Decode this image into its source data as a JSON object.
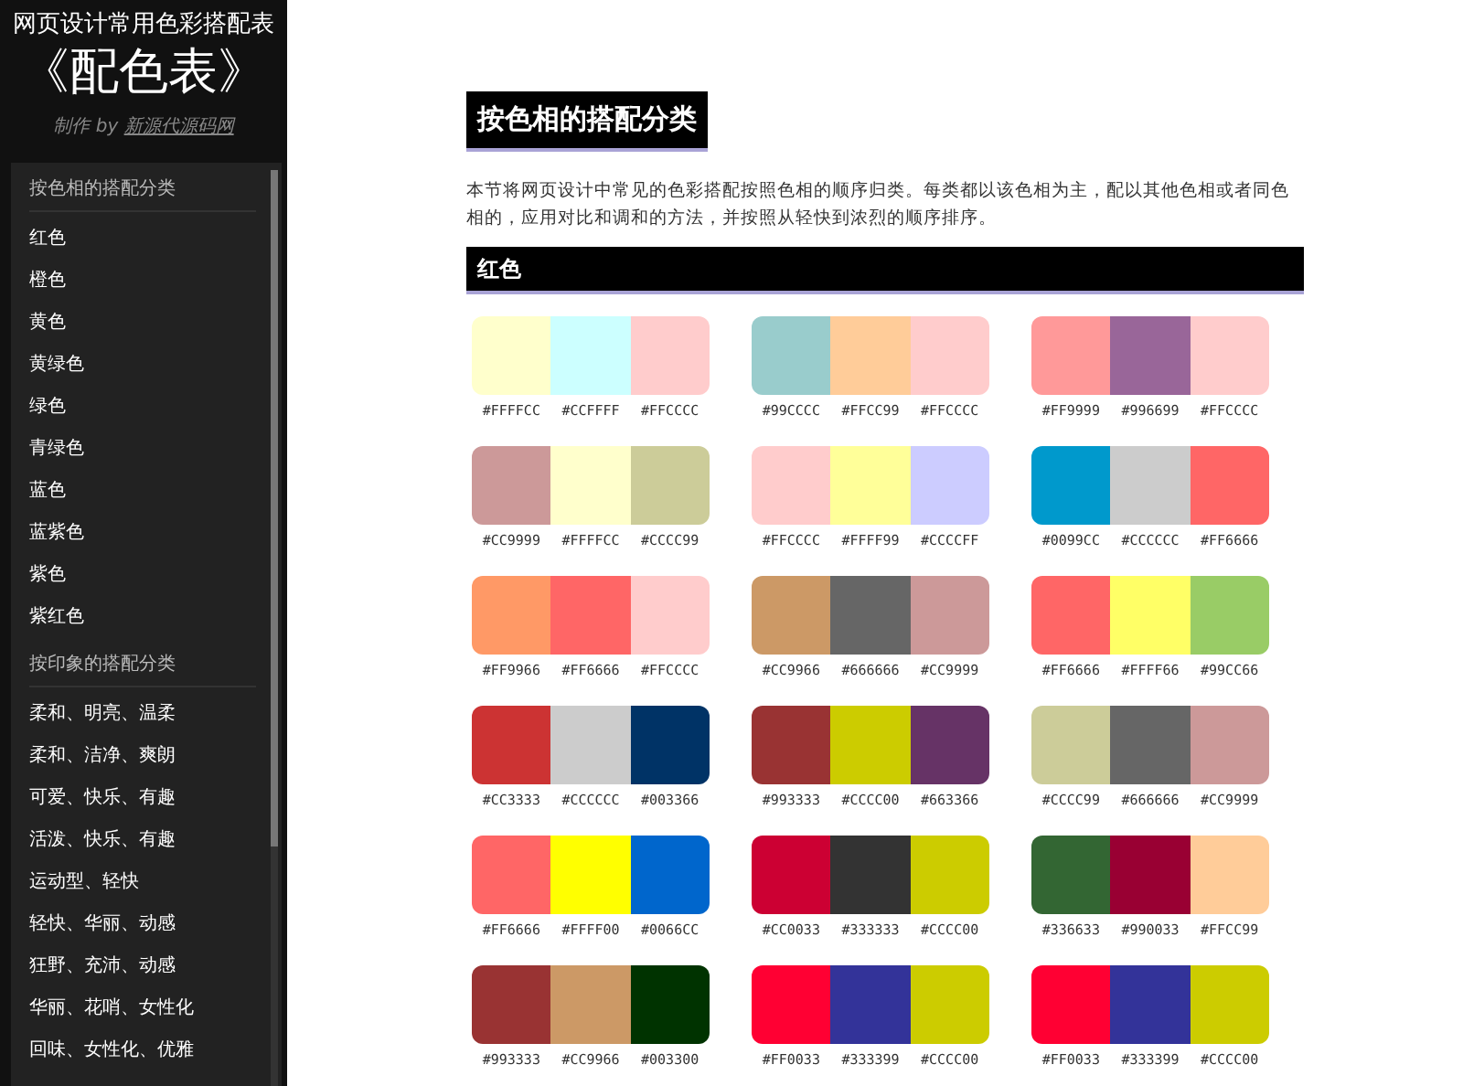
{
  "sidebar": {
    "title": "网页设计常用色彩搭配表",
    "logo": "《配色表》",
    "credit": "制作 by ",
    "credit_link": "新源代源码网",
    "sections": [
      {
        "heading": "按色相的搭配分类",
        "items": [
          "红色",
          "橙色",
          "黄色",
          "黄绿色",
          "绿色",
          "青绿色",
          "蓝色",
          "蓝紫色",
          "紫色",
          "紫红色"
        ]
      },
      {
        "heading": "按印象的搭配分类",
        "items": [
          "柔和、明亮、温柔",
          "柔和、洁净、爽朗",
          "可爱、快乐、有趣",
          "活泼、快乐、有趣",
          "运动型、轻快",
          "轻快、华丽、动感",
          "狂野、充沛、动感",
          "华丽、花哨、女性化",
          "回味、女性化、优雅"
        ]
      }
    ]
  },
  "main": {
    "heading": "按色相的搭配分类",
    "intro": "本节将网页设计中常见的色彩搭配按照色相的顺序归类。每类都以该色相为主，配以其他色相或者同色相的，应用对比和调和的方法，并按照从轻快到浓烈的顺序排序。",
    "section_title": "红色",
    "palettes": [
      [
        {
          "color": "#ffffcc",
          "label": "#FFFFCC"
        },
        {
          "color": "#ccffff",
          "label": "#CCFFFF"
        },
        {
          "color": "#ffcccc",
          "label": "#FFCCCC"
        }
      ],
      [
        {
          "color": "#99cccc",
          "label": "#99CCCC"
        },
        {
          "color": "#ffcc99",
          "label": "#FFCC99"
        },
        {
          "color": "#ffcccc",
          "label": "#FFCCCC"
        }
      ],
      [
        {
          "color": "#ff9999",
          "label": "#FF9999"
        },
        {
          "color": "#996699",
          "label": "#996699"
        },
        {
          "color": "#ffcccc",
          "label": "#FFCCCC"
        }
      ],
      [
        {
          "color": "#cc9999",
          "label": "#CC9999"
        },
        {
          "color": "#ffffcc",
          "label": "#FFFFCC"
        },
        {
          "color": "#cccc99",
          "label": "#CCCC99"
        }
      ],
      [
        {
          "color": "#ffcccc",
          "label": "#FFCCCC"
        },
        {
          "color": "#ffff99",
          "label": "#FFFF99"
        },
        {
          "color": "#ccccff",
          "label": "#CCCCFF"
        }
      ],
      [
        {
          "color": "#0099cc",
          "label": "#0099CC"
        },
        {
          "color": "#cccccc",
          "label": "#CCCCCC"
        },
        {
          "color": "#ff6666",
          "label": "#FF6666"
        }
      ],
      [
        {
          "color": "#ff9966",
          "label": "#FF9966"
        },
        {
          "color": "#ff6666",
          "label": "#FF6666"
        },
        {
          "color": "#ffcccc",
          "label": "#FFCCCC"
        }
      ],
      [
        {
          "color": "#cc9966",
          "label": "#CC9966"
        },
        {
          "color": "#666666",
          "label": "#666666"
        },
        {
          "color": "#cc9999",
          "label": "#CC9999"
        }
      ],
      [
        {
          "color": "#ff6666",
          "label": "#FF6666"
        },
        {
          "color": "#ffff66",
          "label": "#FFFF66"
        },
        {
          "color": "#99cc66",
          "label": "#99CC66"
        }
      ],
      [
        {
          "color": "#cc3333",
          "label": "#CC3333"
        },
        {
          "color": "#cccccc",
          "label": "#CCCCCC"
        },
        {
          "color": "#003366",
          "label": "#003366"
        }
      ],
      [
        {
          "color": "#993333",
          "label": "#993333"
        },
        {
          "color": "#cccc00",
          "label": "#CCCC00"
        },
        {
          "color": "#663366",
          "label": "#663366"
        }
      ],
      [
        {
          "color": "#cccc99",
          "label": "#CCCC99"
        },
        {
          "color": "#666666",
          "label": "#666666"
        },
        {
          "color": "#cc9999",
          "label": "#CC9999"
        }
      ],
      [
        {
          "color": "#ff6666",
          "label": "#FF6666"
        },
        {
          "color": "#ffff00",
          "label": "#FFFF00"
        },
        {
          "color": "#0066cc",
          "label": "#0066CC"
        }
      ],
      [
        {
          "color": "#cc0033",
          "label": "#CC0033"
        },
        {
          "color": "#333333",
          "label": "#333333"
        },
        {
          "color": "#cccc00",
          "label": "#CCCC00"
        }
      ],
      [
        {
          "color": "#336633",
          "label": "#336633"
        },
        {
          "color": "#990033",
          "label": "#990033"
        },
        {
          "color": "#ffcc99",
          "label": "#FFCC99"
        }
      ],
      [
        {
          "color": "#993333",
          "label": "#993333"
        },
        {
          "color": "#cc9966",
          "label": "#CC9966"
        },
        {
          "color": "#003300",
          "label": "#003300"
        }
      ],
      [
        {
          "color": "#ff0033",
          "label": "#FF0033"
        },
        {
          "color": "#333399",
          "label": "#333399"
        },
        {
          "color": "#cccc00",
          "label": "#CCCC00"
        }
      ],
      [
        {
          "color": "#ff0033",
          "label": "#FF0033"
        },
        {
          "color": "#333399",
          "label": "#333399"
        },
        {
          "color": "#cccc00",
          "label": "#CCCC00"
        }
      ]
    ]
  }
}
